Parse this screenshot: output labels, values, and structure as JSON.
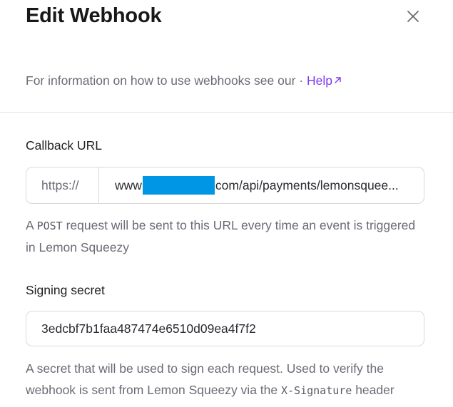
{
  "modal": {
    "title": "Edit Webhook",
    "close_icon": "close-icon"
  },
  "info": {
    "text": "For information on how to use webhooks see our",
    "separator": " · ",
    "help_link_label": "Help",
    "help_link_icon": "external-link-icon"
  },
  "callback": {
    "label": "Callback URL",
    "prefix": "https://",
    "value_start": "www",
    "value_end": "com/api/payments/lemonsquee...",
    "help_before": "A ",
    "help_code": "POST",
    "help_after": " request will be sent to this URL every time an event is triggered in Lemon Squeezy"
  },
  "secret": {
    "label": "Signing secret",
    "value": "3edcbf7b1faa487474e6510d09ea4f7f2",
    "help_before": "A secret that will be used to sign each request. Used to verify the webhook is sent from Lemon Squeezy via the ",
    "help_code": "X-Signature",
    "help_after": " header"
  },
  "colors": {
    "accent": "#7c3aed",
    "redaction": "#0096e6",
    "muted_text": "#6b6b76",
    "border": "#d9d9de"
  }
}
